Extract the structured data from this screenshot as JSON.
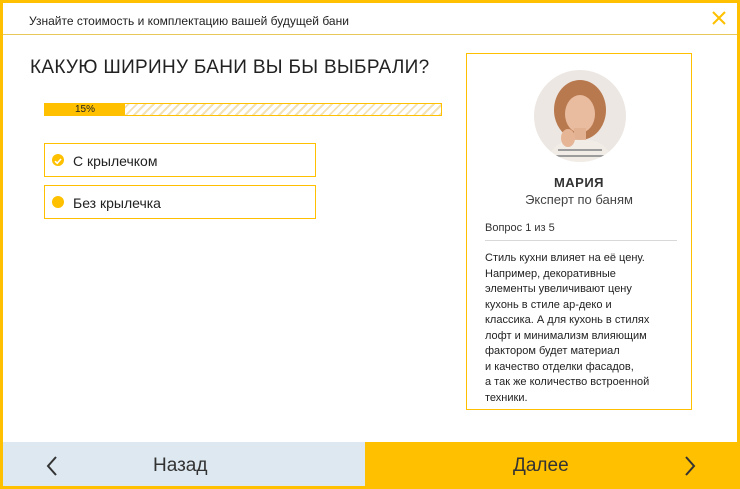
{
  "header": {
    "title": "Узнайте стоимость и комплектацию вашей будущей бани",
    "close_icon": "close-icon"
  },
  "quiz": {
    "question": "КАКУЮ ШИРИНУ БАНИ ВЫ БЫ ВЫБРАЛИ?",
    "progress": {
      "percent": 15,
      "label": "15%"
    },
    "options": [
      {
        "label": "С крылечком",
        "selected": true
      },
      {
        "label": "Без крылечка",
        "selected": false
      }
    ]
  },
  "expert": {
    "name": "МАРИЯ",
    "role": "Эксперт по баням",
    "question_counter": "Вопрос 1 из 5",
    "tip_lines": [
      "Стиль кухни влияет на её цену.",
      "Например, декоративные",
      "элементы увеличивают цену",
      "кухонь в стиле ар-деко и",
      "классика. А для кухонь в стилях",
      "лофт и минимализм влияющим",
      "фактором будет материал",
      "и качество отделки фасадов,",
      "а так же количество встроенной",
      "техники."
    ]
  },
  "footer": {
    "back_label": "Назад",
    "next_label": "Далее"
  },
  "colors": {
    "accent": "#ffc000",
    "back_button": "#dde8f0",
    "text": "#222222"
  }
}
